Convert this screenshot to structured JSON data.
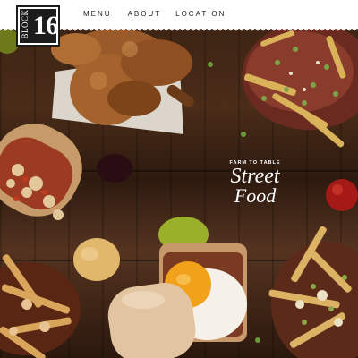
{
  "brand": {
    "logo_word": "BLOCK",
    "logo_number": "16"
  },
  "nav": {
    "items": [
      "MENU",
      "ABOUT",
      "LOCATION"
    ]
  },
  "hero": {
    "tagline_small": "FARM TO TABLE",
    "tagline_line1": "Street",
    "tagline_line2": "Food"
  },
  "colors": {
    "header_bg": "#ffffff",
    "logo_bg": "#1c1c1c",
    "table_wood": "#3a2213",
    "tagline_text": "#ffffff"
  }
}
